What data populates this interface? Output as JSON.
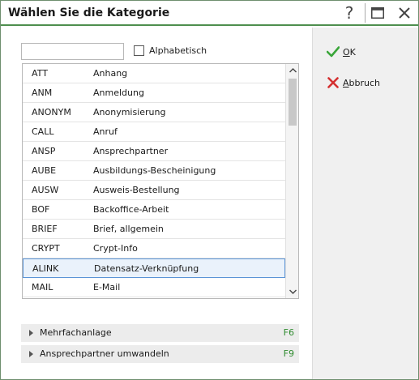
{
  "window": {
    "title": "Wählen Sie die Kategorie"
  },
  "titlebar_buttons": {
    "help": "?",
    "maximize": "maximize-icon",
    "close": "close-icon"
  },
  "search": {
    "value": "",
    "placeholder": ""
  },
  "alphabetical": {
    "label": "Alphabetisch",
    "checked": false
  },
  "categories": [
    {
      "code": "ATT",
      "name": "Anhang"
    },
    {
      "code": "ANM",
      "name": "Anmeldung"
    },
    {
      "code": "ANONYM",
      "name": "Anonymisierung"
    },
    {
      "code": "CALL",
      "name": "Anruf"
    },
    {
      "code": "ANSP",
      "name": "Ansprechpartner"
    },
    {
      "code": "AUBE",
      "name": "Ausbildungs-Bescheinigung"
    },
    {
      "code": "AUSW",
      "name": "Ausweis-Bestellung"
    },
    {
      "code": "BOF",
      "name": "Backoffice-Arbeit"
    },
    {
      "code": "BRIEF",
      "name": "Brief, allgemein"
    },
    {
      "code": "CRYPT",
      "name": "Crypt-Info"
    },
    {
      "code": "ALINK",
      "name": "Datensatz-Verknüpfung",
      "selected": true
    },
    {
      "code": "MAIL",
      "name": "E-Mail"
    }
  ],
  "actions": [
    {
      "label": "Mehrfachanlage",
      "key": "F6"
    },
    {
      "label": "Ansprechpartner umwandeln",
      "key": "F9"
    }
  ],
  "side_buttons": {
    "ok": {
      "label": "OK",
      "mnemonic": "O",
      "rest": "K",
      "icon": "check-icon",
      "color": "#3aa63a"
    },
    "cancel": {
      "label": "Abbruch",
      "mnemonic": "A",
      "rest": "bbruch",
      "icon": "cross-icon",
      "color": "#d43030"
    }
  },
  "colors": {
    "accent": "#4e8f4e",
    "selection_border": "#5b94d6",
    "shortcut": "#2e8b2e"
  }
}
